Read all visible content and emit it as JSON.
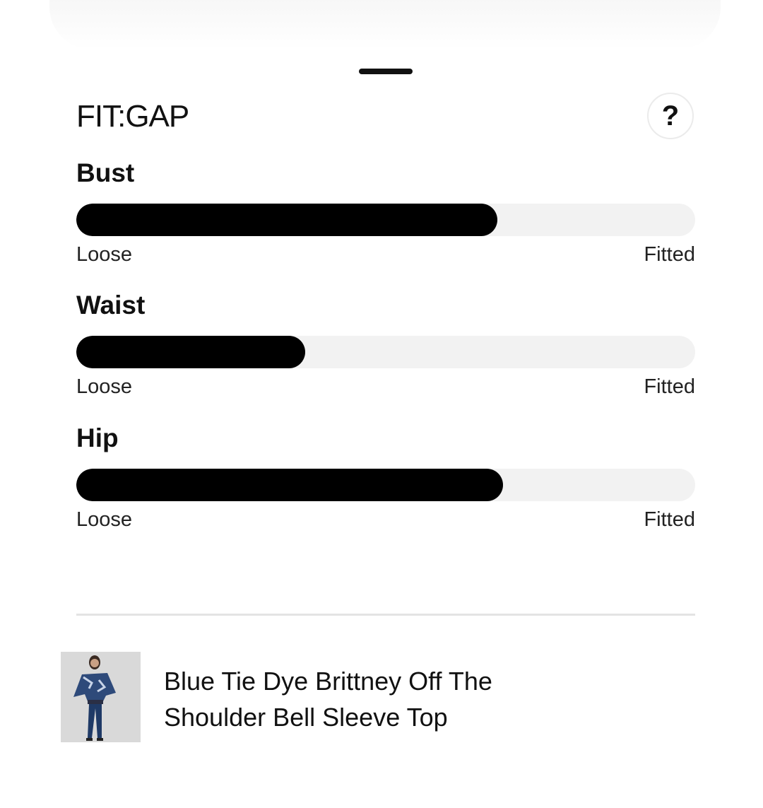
{
  "sheet": {
    "title": "FIT:GAP",
    "help_label": "?"
  },
  "metrics": [
    {
      "label": "Bust",
      "value": 0.68,
      "low_label": "Loose",
      "high_label": "Fitted"
    },
    {
      "label": "Waist",
      "value": 0.37,
      "low_label": "Loose",
      "high_label": "Fitted"
    },
    {
      "label": "Hip",
      "value": 0.69,
      "low_label": "Loose",
      "high_label": "Fitted"
    }
  ],
  "product": {
    "name": "Blue Tie Dye Brittney Off The Shoulder Bell Sleeve Top"
  },
  "colors": {
    "fill": "#000000",
    "track": "#f2f2f2"
  }
}
